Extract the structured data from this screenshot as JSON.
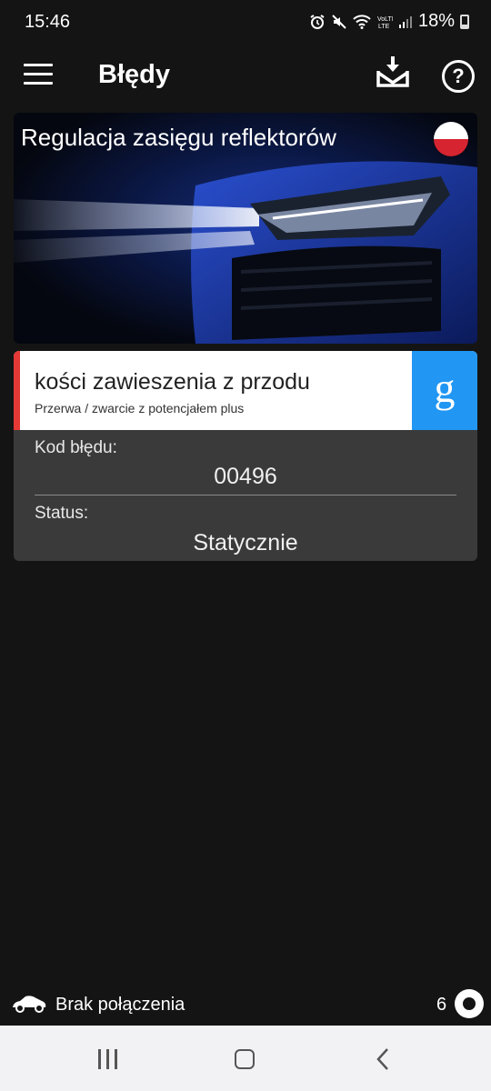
{
  "status_bar": {
    "time": "15:46",
    "battery": "18%",
    "icons": [
      "alarm-icon",
      "mute-icon",
      "wifi-icon",
      "volte-icon",
      "signal-icon",
      "battery-icon"
    ]
  },
  "app_bar": {
    "title": "Błędy",
    "menu_icon": "hamburger-menu-icon",
    "download_icon": "inbox-download-icon",
    "help_label": "?"
  },
  "banner": {
    "title": "Regulacja zasięgu reflektorów",
    "flag": "poland-flag"
  },
  "error": {
    "title": "kości zawieszenia z przodu",
    "subtitle": "Przerwa / zwarcie z potencjałem plus",
    "search_label": "g",
    "code_label": "Kod błędu:",
    "code_value": "00496",
    "status_label": "Status:",
    "status_value": "Statycznie",
    "accent_color": "#e53935",
    "search_color": "#2196f3"
  },
  "connection": {
    "text": "Brak połączenia",
    "count": "6"
  },
  "colors": {
    "background": "#141414",
    "card": "#3a3a3a",
    "nav_bar": "#f2f2f4"
  }
}
